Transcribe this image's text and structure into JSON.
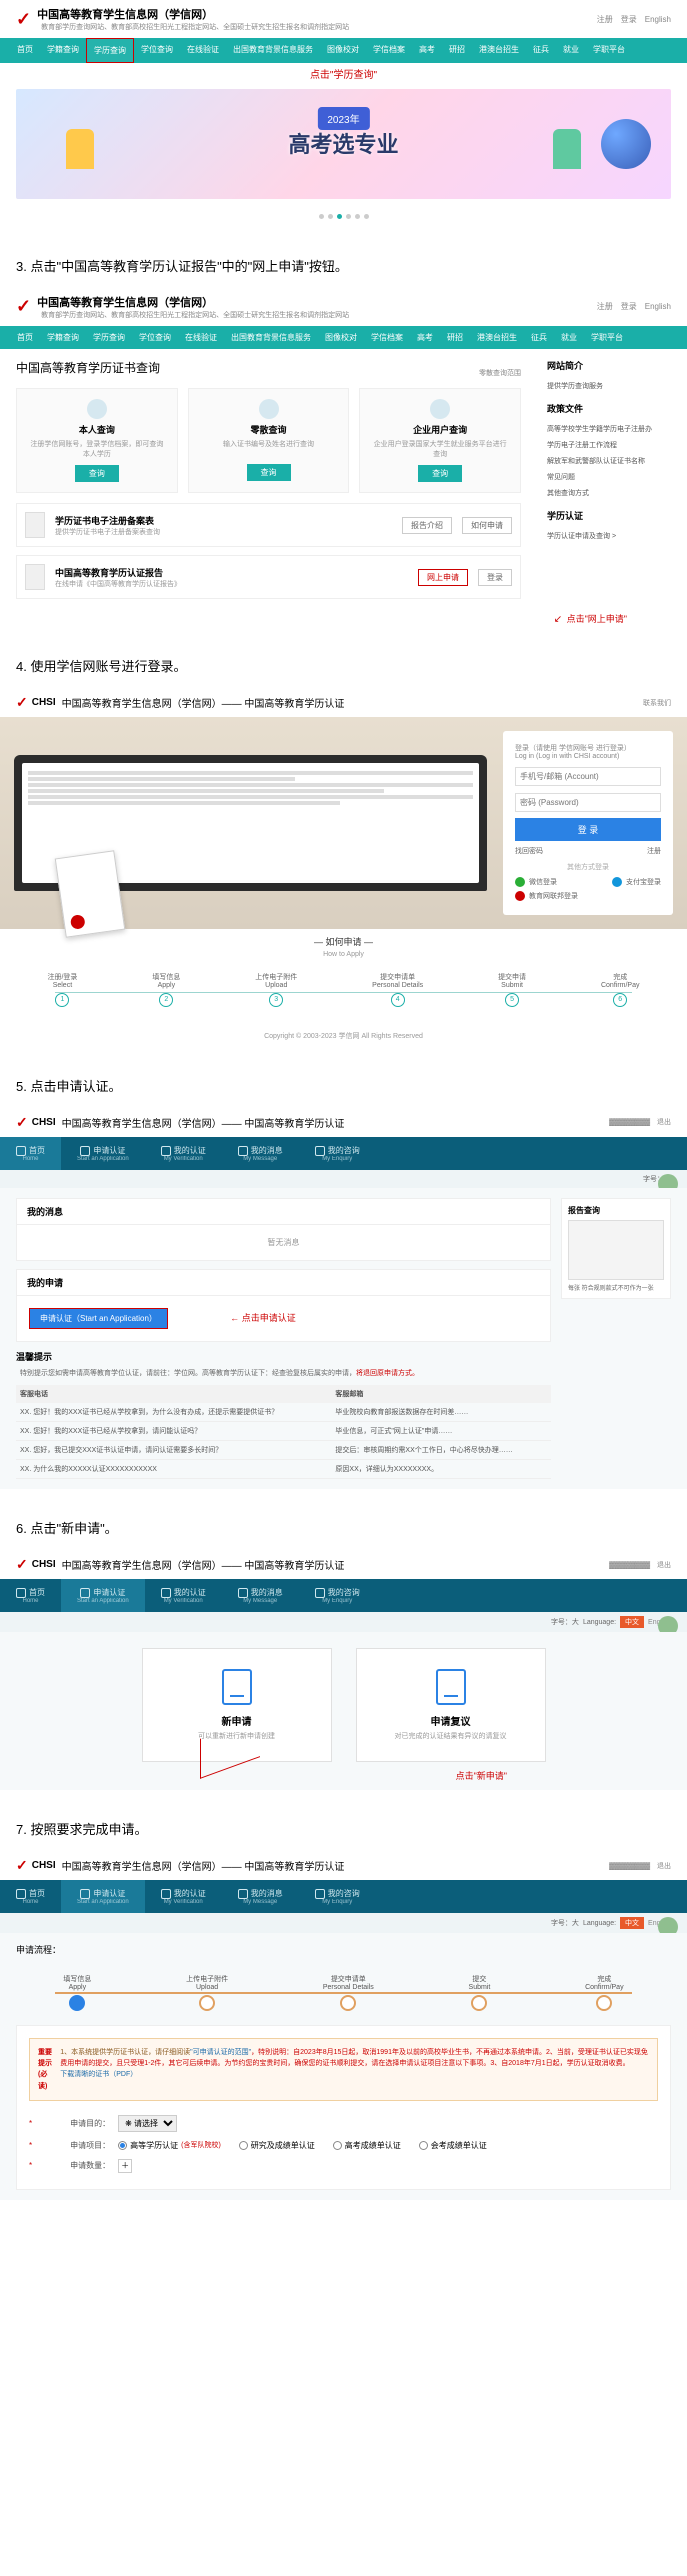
{
  "common": {
    "logo": "CHSI",
    "site_title": "中国高等教育学生信息网（学信网）",
    "site_sub": "教育部学历查询网站、教育部高校招生阳光工程指定网站、全国硕士研究生招生报名和调剂指定网站",
    "top_links": "注册　登录　English"
  },
  "nav": {
    "items": [
      "首页",
      "学籍查询",
      "学历查询",
      "学位查询",
      "在线验证",
      "出国教育背景信息服务",
      "图像校对",
      "学信档案",
      "高考",
      "研招",
      "港澳台招生",
      "征兵",
      "就业",
      "学职平台"
    ],
    "callout": "点击\"学历查询\""
  },
  "banner": {
    "year": "2023年",
    "big": "高考选专业"
  },
  "step3": "3. 点击\"中国高等教育学历认证报告\"中的\"网上申请\"按钮。",
  "sec3": {
    "title": "中国高等教育学历证书查询",
    "fee_note": "零散查询范围",
    "cards": [
      {
        "t": "本人查询",
        "d": "注册学信网账号，登录学信档案，即可查询本人学历"
      },
      {
        "t": "零散查询",
        "d": "输入证书编号及姓名进行查询"
      },
      {
        "t": "企业用户查询",
        "d": "企业用户登录国家大学生就业服务平台进行查询"
      }
    ],
    "btn_query": "查询",
    "reg_box": {
      "t": "学历证书电子注册备案表",
      "d": "提供学历证书电子注册备案表查询",
      "btn1": "报告介绍",
      "btn2": "如何申请"
    },
    "rpt_box": {
      "t": "中国高等教育学历认证报告",
      "d": "在线申请《中国高等教育学历认证报告》",
      "btn1": "网上申请",
      "btn2": "登录"
    },
    "side": {
      "h1": "网站简介",
      "l1": "提供学历查询服务",
      "h2": "政策文件",
      "links": [
        "高等学校学生学籍学历电子注册办",
        "学历电子注册工作流程",
        "解放军和武警部队认证证书名称",
        "常见问题",
        "其他查询方式"
      ],
      "h3": "学历认证",
      "l3": "学历认证申请及查询 >"
    },
    "callout": "点击\"网上申请\""
  },
  "step4": "4. 使用学信网账号进行登录。",
  "sec4": {
    "bar_title": "中国高等教育学生信息网（学信网）—— 中国高等教育学历认证",
    "bar_right": "联系我们",
    "login_hint": "登录（请使用 学信网账号 进行登录）\nLog in  (Log in with CHSI account)",
    "ph_account": "手机号/邮箱 (Account)",
    "ph_pass": "密码 (Password)",
    "btn_login": "登 录",
    "links": {
      "a": "找回密码",
      "b": "注册"
    },
    "alt_title": "其他方式登录",
    "alt1": "微信登录",
    "alt2": "支付宝登录",
    "alt3": "教育网联邦登录",
    "how_apply": "— 如何申请 —",
    "how_apply_en": "How to Apply",
    "steps": [
      {
        "cn": "注册/登录",
        "en": "Select"
      },
      {
        "cn": "填写信息",
        "en": "Apply"
      },
      {
        "cn": "上传电子附件",
        "en": "Upload"
      },
      {
        "cn": "提交申请单",
        "en": "Personal Details"
      },
      {
        "cn": "提交申请",
        "en": "Submit"
      },
      {
        "cn": "完成",
        "en": "Confirm/Pay"
      }
    ],
    "copyright": "Copyright © 2003-2023 学信网 All Rights Reserved"
  },
  "step5": "5. 点击申请认证。",
  "bluenav": {
    "items": [
      {
        "cn": "首页",
        "en": "Home"
      },
      {
        "cn": "申请认证",
        "en": "Start an Application"
      },
      {
        "cn": "我的认证",
        "en": "My Verification"
      },
      {
        "cn": "我的消息",
        "en": "My Message"
      },
      {
        "cn": "我的咨询",
        "en": "My Enquiry"
      }
    ]
  },
  "subbar": {
    "size": "字号：大",
    "lang": "Language:",
    "cn": "中文",
    "en": "English"
  },
  "sec5": {
    "panel1_h": "我的消息",
    "panel1_b": "暂无消息",
    "panel2_h": "我的申请",
    "btn_apply": "申请认证（Start an Application）",
    "notice_h": "温馨提示",
    "notice": "特别提示您如需申请高等教育学位认证，请前往：学位网。高等教育学历认证下：经查验复核后属实的申请，",
    "notice_red": "将退回原申请方式。",
    "callout": "点击申请认证",
    "faq_h": "客服电话",
    "faq_h2": "客服邮箱",
    "faq": [
      {
        "q": "XX. 您好！我的XXX证书已经从学校拿到，为什么没有办成，还提示需要提供证书？",
        "a": "毕业院校向教育部报送数据存在时间差……"
      },
      {
        "q": "XX. 您好！我的XXX证书已经从学校拿到，请问能认证吗？",
        "a": "毕业信息，可正式\"网上认证\"申请……"
      },
      {
        "q": "XX. 您好，我已提交XXX证书认证申请，请问认证需要多长时间？",
        "a": "提交后：审核周期约需XX个工作日，中心将尽快办理……"
      },
      {
        "q": "XX. 为什么我的XXXXX认证XXXXXXXXXXX",
        "a": "原因XX，详细认为XXXXXXXX。"
      }
    ],
    "side_h": "报告查询",
    "side_cap": "每张 符合规则款式不可作为一张"
  },
  "step6": "6. 点击\"新申请\"。",
  "sec6": {
    "card1_t": "新申请",
    "card1_d": "可以重新进行新申请创建",
    "card2_t": "申请复议",
    "card2_d": "对已完成的认证结果有异议的请复议",
    "callout": "点击\"新申请\""
  },
  "step7": "7. 按照要求完成申请。",
  "sec7": {
    "head": "申请流程：",
    "steps": [
      {
        "cn": "填写信息",
        "en": "Apply"
      },
      {
        "cn": "上传电子附件",
        "en": "Upload"
      },
      {
        "cn": "提交申请单",
        "en": "Personal Details"
      },
      {
        "cn": "提交",
        "en": "Submit"
      },
      {
        "cn": "完成",
        "en": "Confirm/Pay"
      }
    ],
    "warn_lbl": "重要提示\n(必读)",
    "warn_body": "1、本系统提供学历证书认证，请仔细阅读",
    "warn_link": "\"可申请认证的范围\"",
    "warn_body2": "，特别说明：自2023年8月15日起，取消1991年及以前的高校毕业生书，不再通过本系统申请。2、当前，受理证书认证已实现免费用申请的提交，且只受理1-2件，其它可后续申请。为节约您的宝贵时间，确保您的证书顺利提交，请在选择申请认证项目注意以下事项。3、自2018年7月1日起，学历认证取消收费。",
    "warn_pdf": "下载清晰的证书（PDF）",
    "form_purpose_lbl": "申请目的：",
    "form_purpose_ph": "❋ 请选择",
    "form_type_lbl": "申请项目：",
    "radio1": "高等学历认证",
    "radio1_red": "(含军队院校)",
    "radio2": "研究及成绩单认证",
    "radio3": "高考成绩单认证",
    "radio4": "会考成绩单认证",
    "form_count_lbl": "申请数量："
  }
}
